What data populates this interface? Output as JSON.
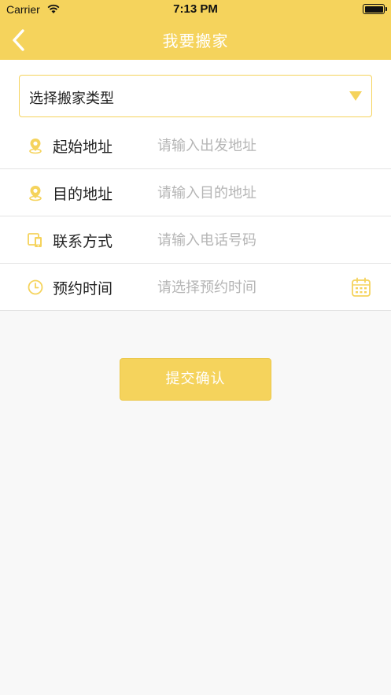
{
  "status_bar": {
    "carrier": "Carrier",
    "time": "7:13 PM"
  },
  "nav": {
    "title": "我要搬家",
    "back_icon": "chevron-left-icon"
  },
  "move_type_select": {
    "selected_value": "选择搬家类型",
    "arrow_icon": "caret-down-icon"
  },
  "form": {
    "rows": [
      {
        "label": "起始地址",
        "placeholder": "请输入出发地址",
        "value": "",
        "icon": "location-pin-icon"
      },
      {
        "label": "目的地址",
        "placeholder": "请输入目的地址",
        "value": "",
        "icon": "location-pin-icon"
      },
      {
        "label": "联系方式",
        "placeholder": "请输入电话号码",
        "value": "",
        "icon": "phone-devices-icon"
      },
      {
        "label": "预约时间",
        "placeholder": "请选择预约时间",
        "value": "",
        "icon": "clock-icon",
        "trailing_icon": "calendar-icon"
      }
    ]
  },
  "submit": {
    "label": "提交确认"
  },
  "colors": {
    "accent": "#f5d35c",
    "placeholder": "#b5b5b5",
    "divider": "#e4e4e4",
    "background": "#f8f8f8"
  }
}
